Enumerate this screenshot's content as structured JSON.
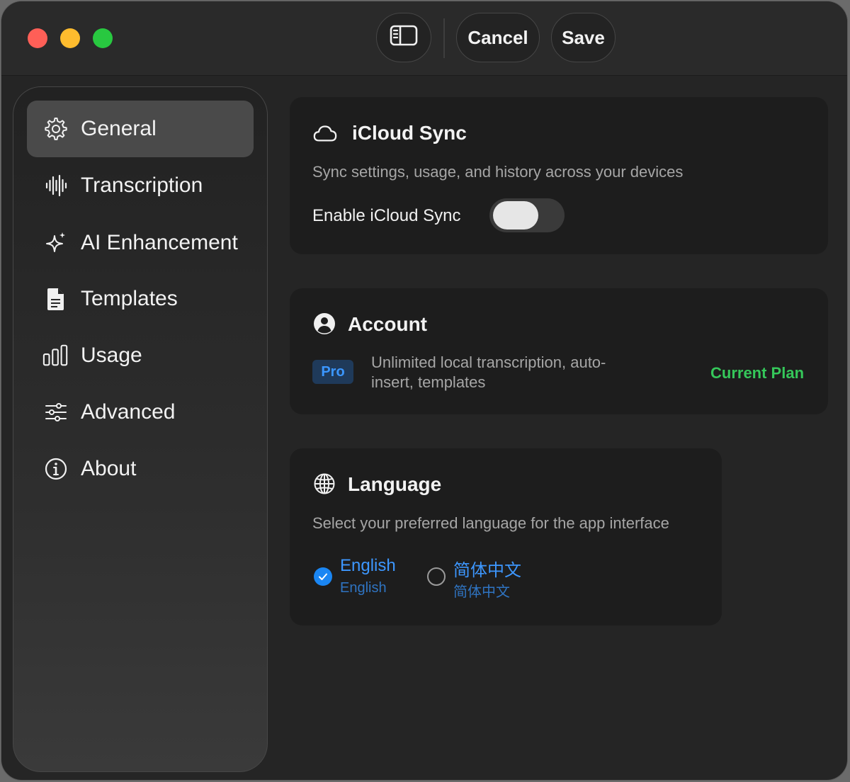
{
  "toolbar": {
    "cancel_label": "Cancel",
    "save_label": "Save"
  },
  "sidebar": {
    "items": [
      {
        "label": "General",
        "icon": "gear-icon",
        "active": true
      },
      {
        "label": "Transcription",
        "icon": "waveform-icon",
        "active": false
      },
      {
        "label": "AI Enhancement",
        "icon": "sparkles-icon",
        "active": false
      },
      {
        "label": "Templates",
        "icon": "document-icon",
        "active": false
      },
      {
        "label": "Usage",
        "icon": "bar-chart-icon",
        "active": false
      },
      {
        "label": "Advanced",
        "icon": "sliders-icon",
        "active": false
      },
      {
        "label": "About",
        "icon": "info-icon",
        "active": false
      }
    ]
  },
  "icloud": {
    "title": "iCloud Sync",
    "description": "Sync settings, usage, and history across your devices",
    "toggle_label": "Enable iCloud Sync",
    "enabled": false
  },
  "account": {
    "title": "Account",
    "badge": "Pro",
    "description_line1": "Unlimited local transcription, auto-",
    "description_line2": "insert, templates",
    "status": "Current Plan"
  },
  "language": {
    "title": "Language",
    "description": "Select your preferred language for the app interface",
    "options": [
      {
        "label": "English",
        "native": "English",
        "selected": true
      },
      {
        "label": "简体中文",
        "native": "简体中文",
        "selected": false
      }
    ]
  },
  "colors": {
    "accent_blue": "#1a86f3",
    "plan_green": "#35c75a",
    "traffic_red": "#fe5f57",
    "traffic_yellow": "#febc2e",
    "traffic_green": "#28c840"
  }
}
